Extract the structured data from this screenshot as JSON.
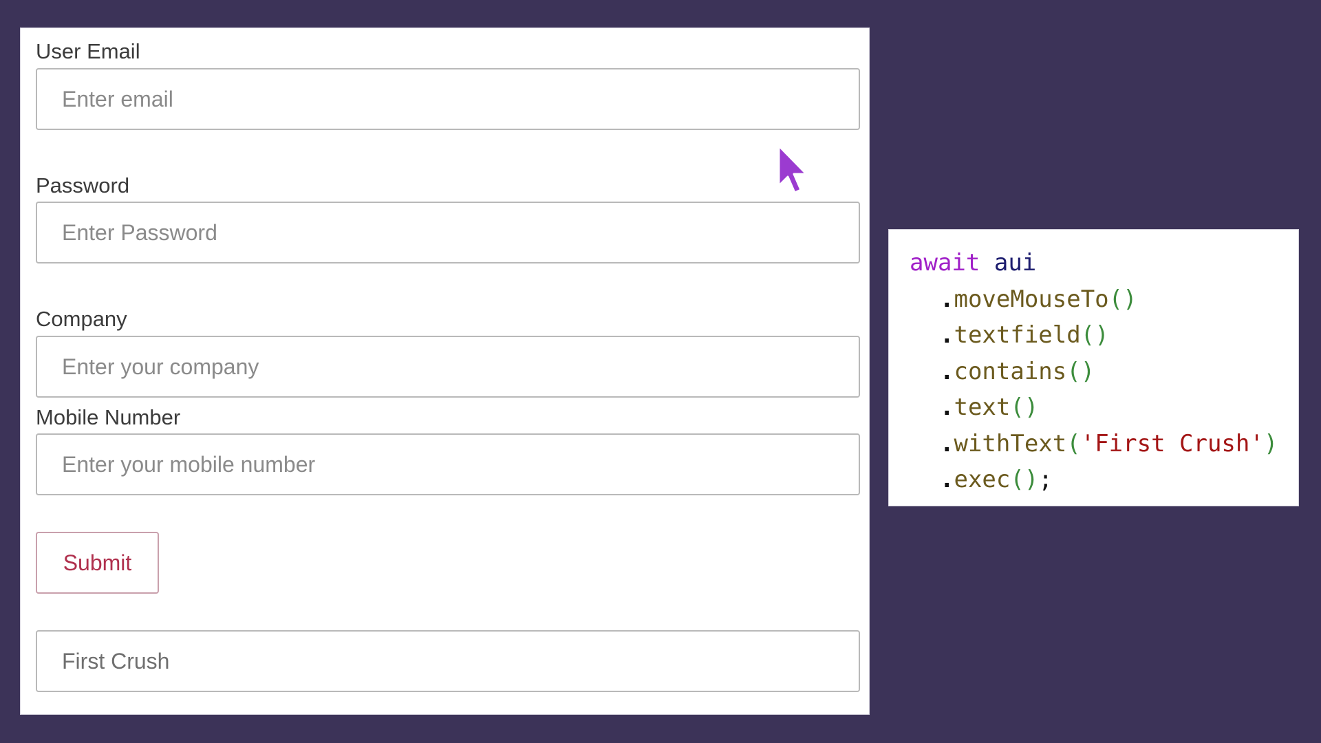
{
  "form": {
    "fields": [
      {
        "label": "User Email",
        "placeholder": "Enter email"
      },
      {
        "label": "Password",
        "placeholder": "Enter Password"
      },
      {
        "label": "Company",
        "placeholder": "Enter your company"
      },
      {
        "label": "Mobile Number",
        "placeholder": "Enter your mobile number"
      }
    ],
    "submit_label": "Submit",
    "result_text": "First Crush"
  },
  "code": {
    "keyword": "await",
    "object": "aui",
    "methods": [
      "moveMouseTo",
      "textfield",
      "contains",
      "text",
      "withText",
      "exec"
    ],
    "string_arg": "'First Crush'",
    "terminator": ";"
  },
  "colors": {
    "background": "#3c3358",
    "cursor": "#9b3bd0",
    "submit_text": "#b0304d",
    "keyword": "#a020c8"
  },
  "icons": {
    "cursor": "mouse-pointer-icon"
  }
}
